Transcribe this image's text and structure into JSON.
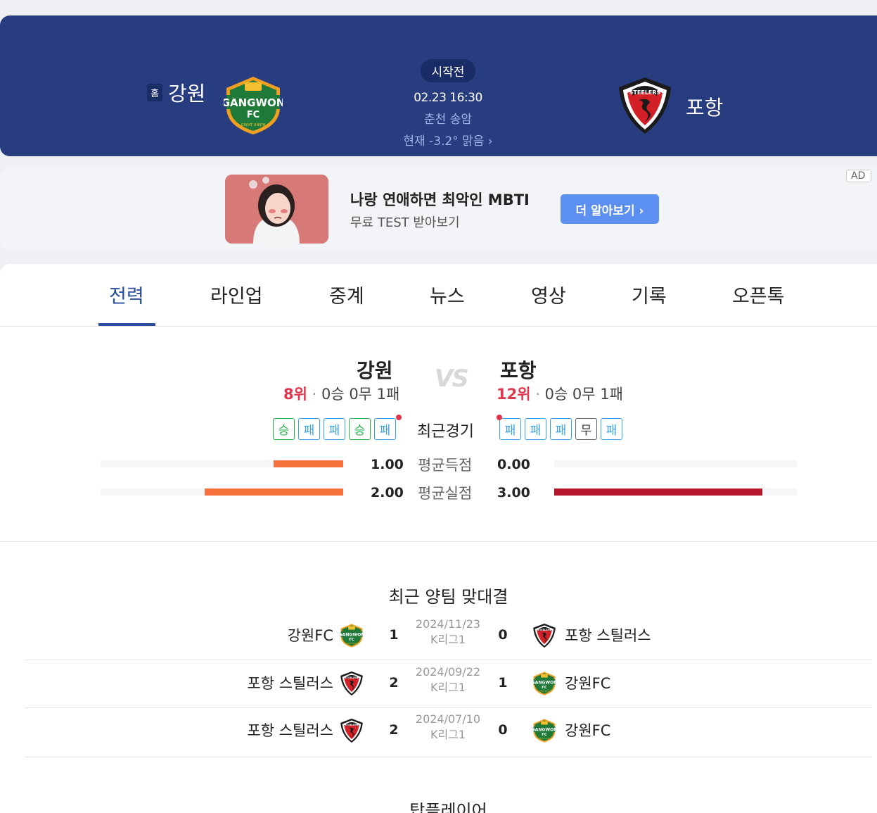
{
  "header": {
    "home_badge": "홈",
    "home_name": "강원",
    "away_name": "포항",
    "status": "시작전",
    "datetime": "02.23 16:30",
    "venue": "춘천 송암",
    "weather": "현재 -3.2° 맑음 ›"
  },
  "ad": {
    "title": "나랑 연애하면 최악인 MBTI",
    "subtitle": "무료 TEST 받아보기",
    "button": "더 알아보기 ›",
    "tag": "AD"
  },
  "tabs": [
    "전력",
    "라인업",
    "중계",
    "뉴스",
    "영상",
    "기록",
    "오픈톡"
  ],
  "active_tab": "전력",
  "comparison": {
    "vs": "VS",
    "home": {
      "name": "강원",
      "rank": "8위",
      "record": "0승 0무 1패",
      "recent": [
        "승",
        "패",
        "패",
        "승",
        "패"
      ],
      "avg_goals": "1.00",
      "avg_conceded": "2.00",
      "avg_goals_value": 1.0,
      "avg_conceded_value": 2.0
    },
    "away": {
      "name": "포항",
      "rank": "12위",
      "record": "0승 0무 1패",
      "recent": [
        "패",
        "패",
        "패",
        "무",
        "패"
      ],
      "avg_goals": "0.00",
      "avg_conceded": "3.00",
      "avg_goals_value": 0.0,
      "avg_conceded_value": 3.0
    },
    "labels": {
      "recent": "최근경기",
      "avg_goals": "평균득점",
      "avg_conceded": "평균실점"
    },
    "colors": {
      "home_bar": "#f5703a",
      "away_bar": "#b5172c"
    }
  },
  "h2h": {
    "title": "최근 양팀 맞대결",
    "matches": [
      {
        "left": "강원FC",
        "left_logo": "gangwon",
        "left_score": "1",
        "date": "2024/11/23",
        "league": "K리그1",
        "right_score": "0",
        "right": "포항 스틸러스",
        "right_logo": "pohang"
      },
      {
        "left": "포항 스틸러스",
        "left_logo": "pohang",
        "left_score": "2",
        "date": "2024/09/22",
        "league": "K리그1",
        "right_score": "1",
        "right": "강원FC",
        "right_logo": "gangwon"
      },
      {
        "left": "포항 스틸러스",
        "left_logo": "pohang",
        "left_score": "2",
        "date": "2024/07/10",
        "league": "K리그1",
        "right_score": "0",
        "right": "강원FC",
        "right_logo": "gangwon"
      }
    ]
  },
  "top_play": {
    "title": "탑플레이어"
  }
}
